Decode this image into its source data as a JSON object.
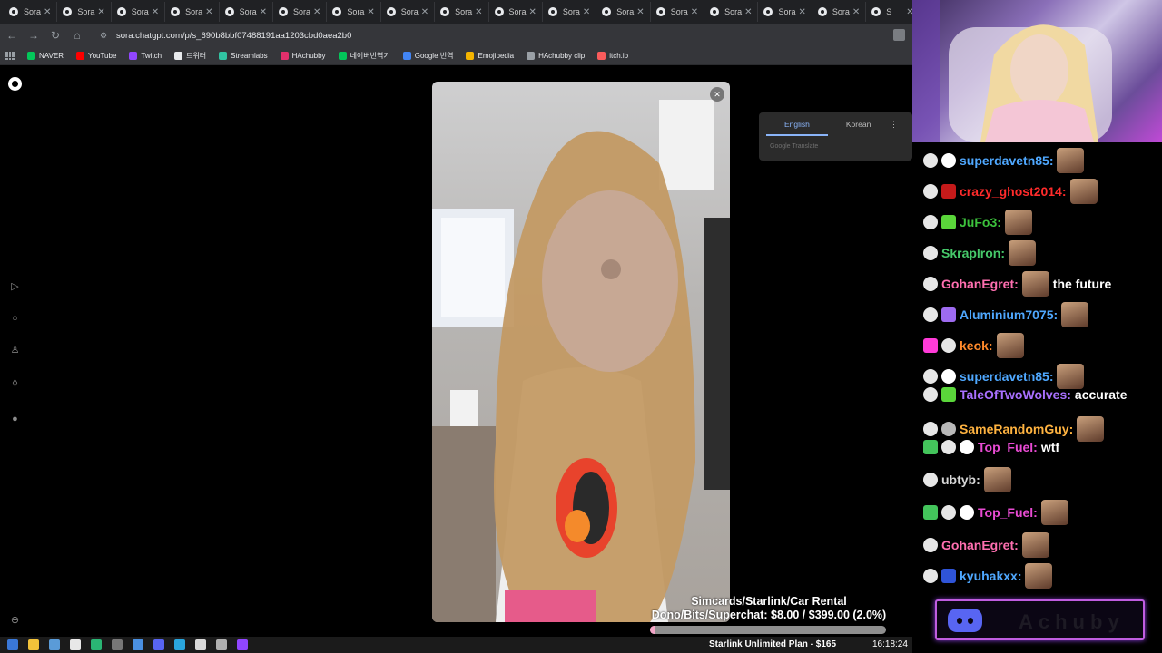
{
  "browser": {
    "tabs": [
      "Sora",
      "Sora",
      "Sora",
      "Sora",
      "Sora",
      "Sora",
      "Sora",
      "Sora",
      "Sora",
      "Sora",
      "Sora",
      "Sora",
      "Sora",
      "Sora",
      "Sora",
      "Sora",
      "S"
    ],
    "url": "sora.chatgpt.com/p/s_690b8bbf07488191aa1203cbd0aea2b0",
    "bookmarks": [
      {
        "label": "NAVER",
        "color": "#03c75a"
      },
      {
        "label": "YouTube",
        "color": "#ff0000"
      },
      {
        "label": "Twitch",
        "color": "#9146ff"
      },
      {
        "label": "트위터",
        "color": "#e8eaed"
      },
      {
        "label": "Streamlabs",
        "color": "#31c3a2"
      },
      {
        "label": "HAchubby",
        "color": "#e1306c"
      },
      {
        "label": "네이버번역기",
        "color": "#03c75a"
      },
      {
        "label": "Google 번역",
        "color": "#4285f4"
      },
      {
        "label": "Emojipedia",
        "color": "#f4b400"
      },
      {
        "label": "HAchubby clip",
        "color": "#9aa0a6"
      },
      {
        "label": "itch.io",
        "color": "#fa5c5c"
      }
    ]
  },
  "translate_popup": {
    "tabs": [
      "English",
      "Korean"
    ],
    "active": "English",
    "footer": "Google Translate"
  },
  "donation": {
    "line1": "Simcards/Starlink/Car Rental",
    "line2": "Dono/Bits/Superchat: $8.00 / $399.00 (2.0%)",
    "progress_fraction": 0.02
  },
  "taskbar": {
    "ticker": "Starlink Unlimited Plan - $165",
    "clock": "16:18:24"
  },
  "chat": [
    {
      "user": "superdavetn85:",
      "color": "#4fa8ff",
      "badges": [
        "crown",
        "skull"
      ],
      "emote": true,
      "text": ""
    },
    {
      "user": "crazy_ghost2014:",
      "color": "#ff2b2b",
      "badges": [
        "crown",
        "red"
      ],
      "emote": true,
      "text": ""
    },
    {
      "user": "JuFo3:",
      "color": "#3cc23c",
      "badges": [
        "crown",
        "green"
      ],
      "emote": true,
      "text": ""
    },
    {
      "user": "Skraplron:",
      "color": "#46c96a",
      "badges": [
        "crown"
      ],
      "emote": true,
      "text": ""
    },
    {
      "user": "GohanEgret:",
      "color": "#ff6fb0",
      "badges": [
        "crown"
      ],
      "emote": true,
      "text": "the future"
    },
    {
      "user": "Aluminium7075:",
      "color": "#4fa8ff",
      "badges": [
        "crown",
        "purple"
      ],
      "emote": true,
      "text": ""
    },
    {
      "user": "keok:",
      "color": "#ff8a2b",
      "badges": [
        "pink",
        "crown"
      ],
      "emote": true,
      "text": ""
    },
    {
      "user": "superdavetn85:",
      "color": "#4fa8ff",
      "badges": [
        "crown",
        "skull"
      ],
      "emote": true,
      "text": ""
    },
    {
      "user": "TaleOfTwoWolves:",
      "color": "#a970ff",
      "badges": [
        "crown",
        "green"
      ],
      "emote": false,
      "text": "accurate"
    },
    {
      "user": "SameRandomGuy:",
      "color": "#ffb340",
      "badges": [
        "crown",
        "grey"
      ],
      "emote": true,
      "text": ""
    },
    {
      "user": "Top_Fuel:",
      "color": "#e94bd3",
      "badges": [
        "greenbox",
        "crown",
        "skull"
      ],
      "emote": false,
      "text": "wtf"
    },
    {
      "user": "ubtyb:",
      "color": "#d6d6d6",
      "badges": [
        "crown"
      ],
      "emote": true,
      "text": ""
    },
    {
      "user": "Top_Fuel:",
      "color": "#e94bd3",
      "badges": [
        "greenbox",
        "crown",
        "skull"
      ],
      "emote": true,
      "text": ""
    },
    {
      "user": "GohanEgret:",
      "color": "#ff6fb0",
      "badges": [
        "crown"
      ],
      "emote": true,
      "text": ""
    },
    {
      "user": "kyuhakxx:",
      "color": "#4fa8ff",
      "badges": [
        "crown",
        "blue"
      ],
      "emote": true,
      "text": ""
    }
  ],
  "discord": {
    "text": "Achuby"
  }
}
